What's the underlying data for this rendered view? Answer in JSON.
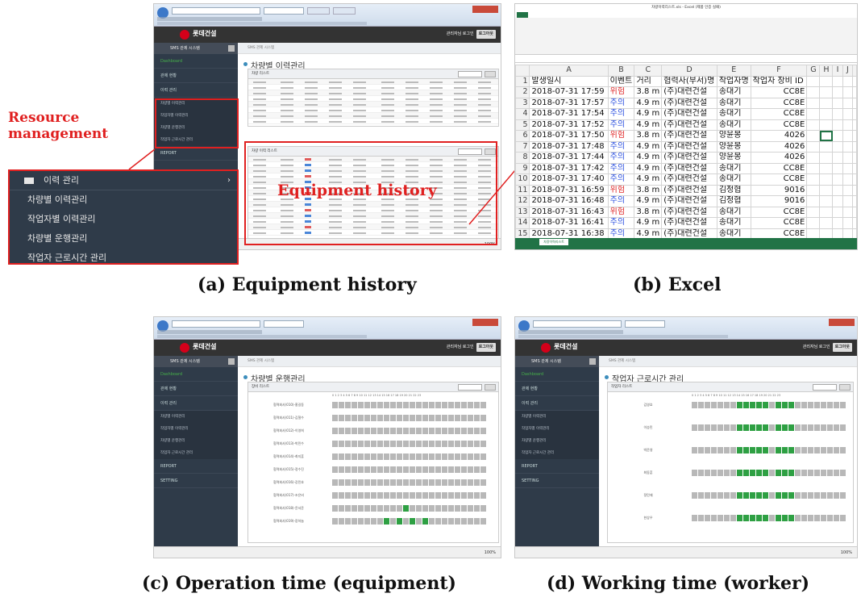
{
  "callout": {
    "resource_label": "Resource management",
    "equipment_label": "Equipment history"
  },
  "captions": {
    "a": "(a) Equipment history",
    "b": "(b) Excel",
    "c": "(c) Operation time (equipment)",
    "d": "(d) Working time (worker)"
  },
  "app": {
    "logo": "롯데건설",
    "logout": "관리자님 로그인",
    "logout_btn": "로그아웃",
    "system_title": "SMS 관제 시스템",
    "sidebar": [
      "Dashboard",
      "관제 현황",
      "이력 관리",
      "REPORT",
      "SETTING"
    ],
    "submenu": [
      "차량별 이력관리",
      "작업자별 이력관리",
      "차량별 운행관리",
      "작업자 근로시간 관리"
    ],
    "zoom_status": "100%"
  },
  "zoom_menu": {
    "head": "이력 관리",
    "items": [
      "차량별 이력관리",
      "작업자별 이력관리",
      "차량별 운행관리",
      "작업자 근로시간 관리"
    ]
  },
  "panel_a": {
    "title": "차량별 이력관리",
    "box1": "차량 리스트",
    "box2": "차량 이력 리스트"
  },
  "panel_c": {
    "title": "차량별 운행관리",
    "box": "장비 리스트",
    "rows": [
      "협력회사(010)-홍길동",
      "협력회사(011)-김철수",
      "협력회사(012)-이영희",
      "협력회사(013)-박민수",
      "협력회사(014)-최지훈",
      "협력회사(015)-정수진",
      "협력회사(016)-강민호",
      "협력회사(017)-조은비",
      "협력회사(018)-윤서준",
      "협력회사(019)-장하늘"
    ]
  },
  "panel_d": {
    "title": "작업자 근로시간 관리",
    "box": "작업자 리스트",
    "rows": [
      "김영호",
      "이승민",
      "박준영",
      "최동훈",
      "정민재",
      "한상우"
    ]
  },
  "excel": {
    "title": "차량이력리스트.xls - Excel (제품 인증 실패)",
    "columns": [
      "A",
      "B",
      "C",
      "D",
      "E",
      "F",
      "G",
      "H",
      "I",
      "J"
    ],
    "header": [
      "발생일시",
      "이벤트",
      "거리",
      "협력사(부서)명",
      "작업자명",
      "작업자 장비 ID"
    ],
    "rows": [
      [
        "2018-07-31 17:59",
        "위험",
        "3.8 m",
        "(주)대련건설",
        "송대기",
        "CC8E"
      ],
      [
        "2018-07-31 17:57",
        "주의",
        "4.9 m",
        "(주)대련건설",
        "송대기",
        "CC8E"
      ],
      [
        "2018-07-31 17:54",
        "주의",
        "4.9 m",
        "(주)대련건설",
        "송대기",
        "CC8E"
      ],
      [
        "2018-07-31 17:52",
        "주의",
        "4.9 m",
        "(주)대련건설",
        "송대기",
        "CC8E"
      ],
      [
        "2018-07-31 17:50",
        "위험",
        "3.8 m",
        "(주)대련건설",
        "양윤봉",
        "4026"
      ],
      [
        "2018-07-31 17:48",
        "주의",
        "4.9 m",
        "(주)대련건설",
        "양윤봉",
        "4026"
      ],
      [
        "2018-07-31 17:44",
        "주의",
        "4.9 m",
        "(주)대련건설",
        "양윤봉",
        "4026"
      ],
      [
        "2018-07-31 17:42",
        "주의",
        "4.9 m",
        "(주)대련건설",
        "송대기",
        "CC8E"
      ],
      [
        "2018-07-31 17:40",
        "주의",
        "4.9 m",
        "(주)대련건설",
        "송대기",
        "CC8E"
      ],
      [
        "2018-07-31 16:59",
        "위험",
        "3.8 m",
        "(주)대련건설",
        "김정협",
        "9016"
      ],
      [
        "2018-07-31 16:48",
        "주의",
        "4.9 m",
        "(주)대련건설",
        "김정협",
        "9016"
      ],
      [
        "2018-07-31 16:43",
        "위험",
        "3.8 m",
        "(주)대련건설",
        "송대기",
        "CC8E"
      ],
      [
        "2018-07-31 16:41",
        "주의",
        "4.9 m",
        "(주)대련건설",
        "송대기",
        "CC8E"
      ],
      [
        "2018-07-31 16:38",
        "주의",
        "4.9 m",
        "(주)대련건설",
        "송대기",
        "CC8E"
      ]
    ],
    "sheet": "차량이력리스트"
  },
  "colors": {
    "danger": "#e02a2a",
    "caution": "#2a4fe0",
    "active": "#2ea043",
    "idle": "#b8b8b8",
    "callout": "#e02020"
  }
}
